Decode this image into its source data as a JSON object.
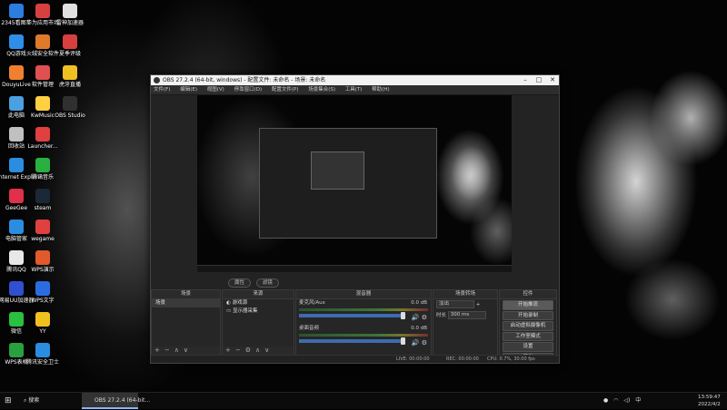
{
  "desktop_icons": [
    {
      "label": "2345看图王",
      "color": "#2b7de0"
    },
    {
      "label": "华为应用市场",
      "color": "#d84040"
    },
    {
      "label": "雷神加速器",
      "color": "#e0e0e0"
    },
    {
      "label": "QQ游戏",
      "color": "#2f8fe8"
    },
    {
      "label": "火绒安全软件",
      "color": "#e07a2b"
    },
    {
      "label": "夏季评级",
      "color": "#d84040"
    },
    {
      "label": "DouyuLive",
      "color": "#f08030"
    },
    {
      "label": "软件管理",
      "color": "#e05050"
    },
    {
      "label": "虎牙直播",
      "color": "#f0c020"
    },
    {
      "label": "此电脑",
      "color": "#4aa0e0"
    },
    {
      "label": "KwMusic",
      "color": "#ffd040"
    },
    {
      "label": "OBS Studio",
      "color": "#303030"
    },
    {
      "label": "回收站",
      "color": "#c0c0c0"
    },
    {
      "label": "Launcher...",
      "color": "#e04040"
    },
    {
      "label": "Internet Explorer",
      "color": "#2b8de0"
    },
    {
      "label": "腾讯音乐",
      "color": "#2ab040"
    },
    {
      "label": "GeeGee",
      "color": "#e0304a"
    },
    {
      "label": "steam",
      "color": "#1b2838"
    },
    {
      "label": "电脑管家",
      "color": "#2b8de0"
    },
    {
      "label": "wegame",
      "color": "#e04040"
    },
    {
      "label": "腾讯QQ",
      "color": "#e8e8e8"
    },
    {
      "label": "WPS演示",
      "color": "#e05a2b"
    },
    {
      "label": "网易UU加速器",
      "color": "#3050d0"
    },
    {
      "label": "WPS文字",
      "color": "#2b6de0"
    },
    {
      "label": "微信",
      "color": "#2ac040"
    },
    {
      "label": "YY",
      "color": "#f0c020"
    },
    {
      "label": "WPS表格",
      "color": "#2aa040"
    },
    {
      "label": "腾讯安全卫士",
      "color": "#2b8de0"
    }
  ],
  "obs": {
    "title": "OBS 27.2.4 (64-bit, windows) - 配置文件: 未命名 - 场景: 未命名",
    "menu": [
      "文件(F)",
      "编辑(E)",
      "视图(V)",
      "停靠窗口(D)",
      "配置文件(P)",
      "场景集合(S)",
      "工具(T)",
      "帮助(H)"
    ],
    "studio_mode": "工作室模式",
    "pill_labels": [
      "属性",
      "滤镜"
    ],
    "docks": {
      "scenes": {
        "title": "场景",
        "items": [
          "场景"
        ]
      },
      "sources": {
        "title": "来源",
        "items": [
          "游戏源",
          "显示器采集"
        ]
      },
      "mixer": {
        "title": "混音器",
        "tracks": [
          {
            "name": "麦克风/Aux",
            "db": "0.0 dB"
          },
          {
            "name": "桌面音频",
            "db": "0.0 dB"
          }
        ]
      },
      "transitions": {
        "title": "场景转场",
        "type": "淡出",
        "duration_label": "时长",
        "duration": "300 ms"
      },
      "controls": {
        "title": "控件",
        "buttons": [
          "开始推流",
          "开始录制",
          "启动虚拟摄像机",
          "工作室模式",
          "设置",
          "退出"
        ]
      }
    },
    "statusbar": {
      "live": "LIVE: 00:00:00",
      "rec": "REC: 00:00:00",
      "cpu": "CPU: 0.7%, 30.00 fps"
    }
  },
  "taskbar": {
    "search": "搜索",
    "obs_item": "OBS 27.2.4 (64-bit...",
    "time": "13:59:47",
    "date": "2022/4/2"
  }
}
